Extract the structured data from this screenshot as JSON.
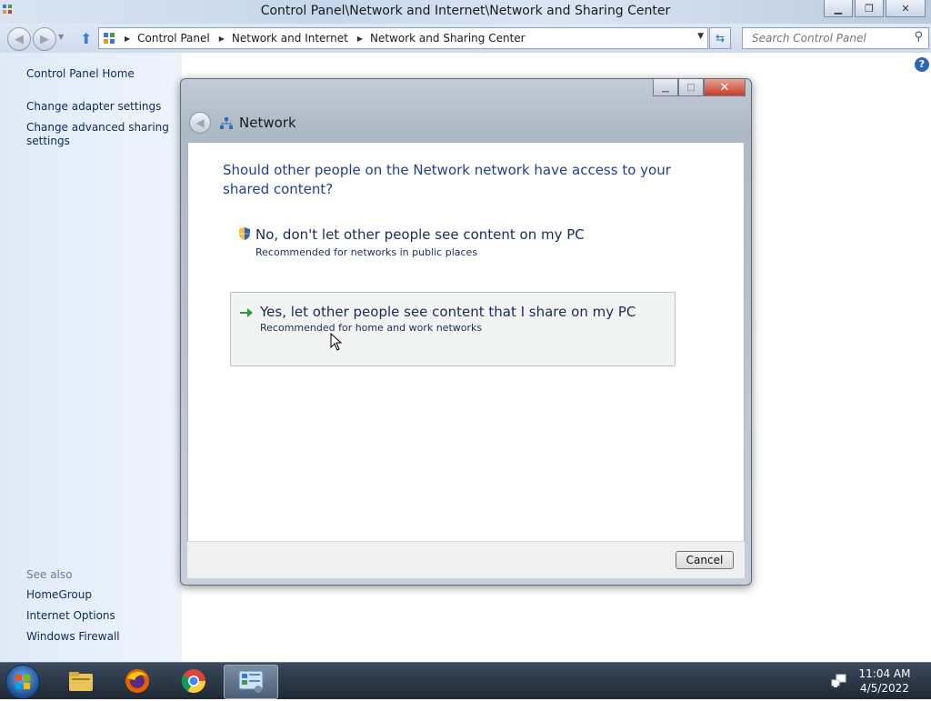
{
  "window": {
    "title": "Control Panel\\Network and Internet\\Network and Sharing Center",
    "minimize_icon": "minimize-icon",
    "maximize_icon": "restore-icon",
    "close_icon": "close-icon"
  },
  "navbar": {
    "breadcrumbs": [
      "Control Panel",
      "Network and Internet",
      "Network and Sharing Center"
    ],
    "search_placeholder": "Search Control Panel"
  },
  "left_pane": {
    "home": "Control Panel Home",
    "links": [
      "Change adapter settings",
      "Change advanced sharing settings"
    ],
    "see_also_label": "See also",
    "see_also": [
      "HomeGroup",
      "Internet Options",
      "Windows Firewall"
    ]
  },
  "dialog": {
    "title": "Network",
    "question": "Should other people on the Network network have access to your shared content?",
    "options": [
      {
        "main": "No, don't let other people see content on my PC",
        "sub": "Recommended for networks in public places",
        "icon": "shield-icon"
      },
      {
        "main": "Yes, let other people see content that I share on my PC",
        "sub": "Recommended for home and work networks",
        "icon": "green-arrow-icon"
      }
    ],
    "cancel_label": "Cancel"
  },
  "taskbar": {
    "items": [
      "file-explorer-icon",
      "firefox-icon",
      "chrome-icon",
      "control-panel-icon"
    ],
    "time": "11:04 AM",
    "date": "4/5/2022"
  },
  "colors": {
    "link": "#0e2a55",
    "dialog_heading": "#1f3f8f"
  }
}
